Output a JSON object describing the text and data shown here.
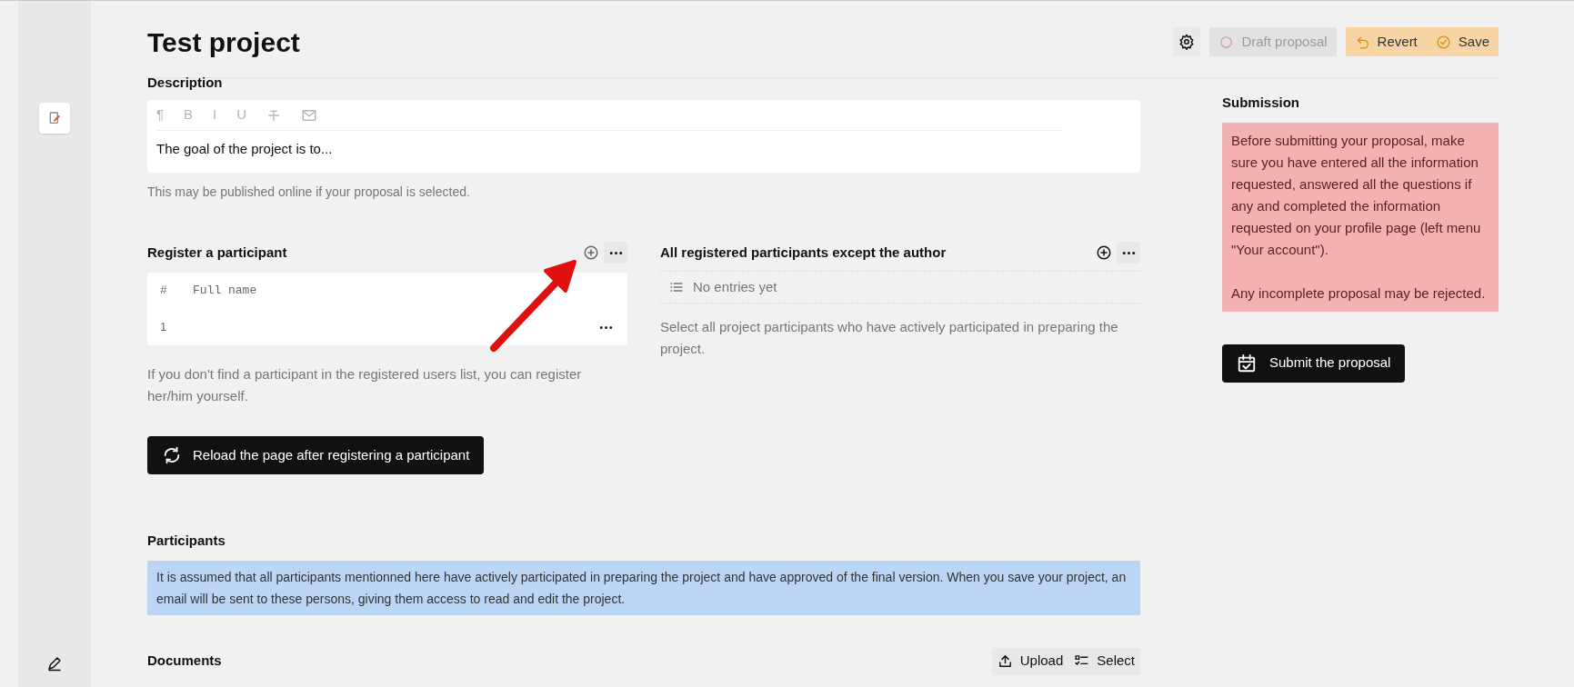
{
  "header": {
    "title": "Test project",
    "buttons": [
      {
        "kind": "draft",
        "label": "Draft proposal",
        "disabled": true
      },
      {
        "kind": "revert",
        "label": "Revert",
        "disabled": false
      },
      {
        "kind": "save",
        "label": "Save",
        "disabled": false
      }
    ]
  },
  "description": {
    "label": "Description",
    "toolbar": [
      "¶",
      "B",
      "I",
      "U"
    ],
    "value": "The goal of the project is to...",
    "help": "This may be published online if your proposal is selected."
  },
  "register": {
    "label": "Register a participant",
    "columns": [
      "#",
      "Full name"
    ],
    "rows": [
      {
        "number": "1"
      }
    ],
    "help": "If you don't find a participant in the registered users list, you can register her/him yourself.",
    "reload_button": "Reload the page after registering a participant"
  },
  "registered": {
    "label": "All registered participants except the author",
    "empty": "No entries yet",
    "help": "Select all project participants who have actively participated in preparing the project."
  },
  "participants": {
    "label": "Participants",
    "notice": "It is assumed that all participants mentionned here have actively participated in preparing the project and have approved of the final version. When you save your project, an email will be sent to these persons, giving them access to read and edit the project."
  },
  "documents": {
    "label": "Documents",
    "actions": [
      {
        "kind": "upload",
        "label": "Upload"
      },
      {
        "kind": "select",
        "label": "Select"
      }
    ]
  },
  "submission": {
    "label": "Submission",
    "warning": [
      "Before submitting your proposal, make sure you have entered all the information requested, answered all the questions if any and completed the information requested on your profile page (left menu \"Your account\").",
      "Any incomplete proposal may be rejected."
    ],
    "button": "Submit the proposal"
  }
}
